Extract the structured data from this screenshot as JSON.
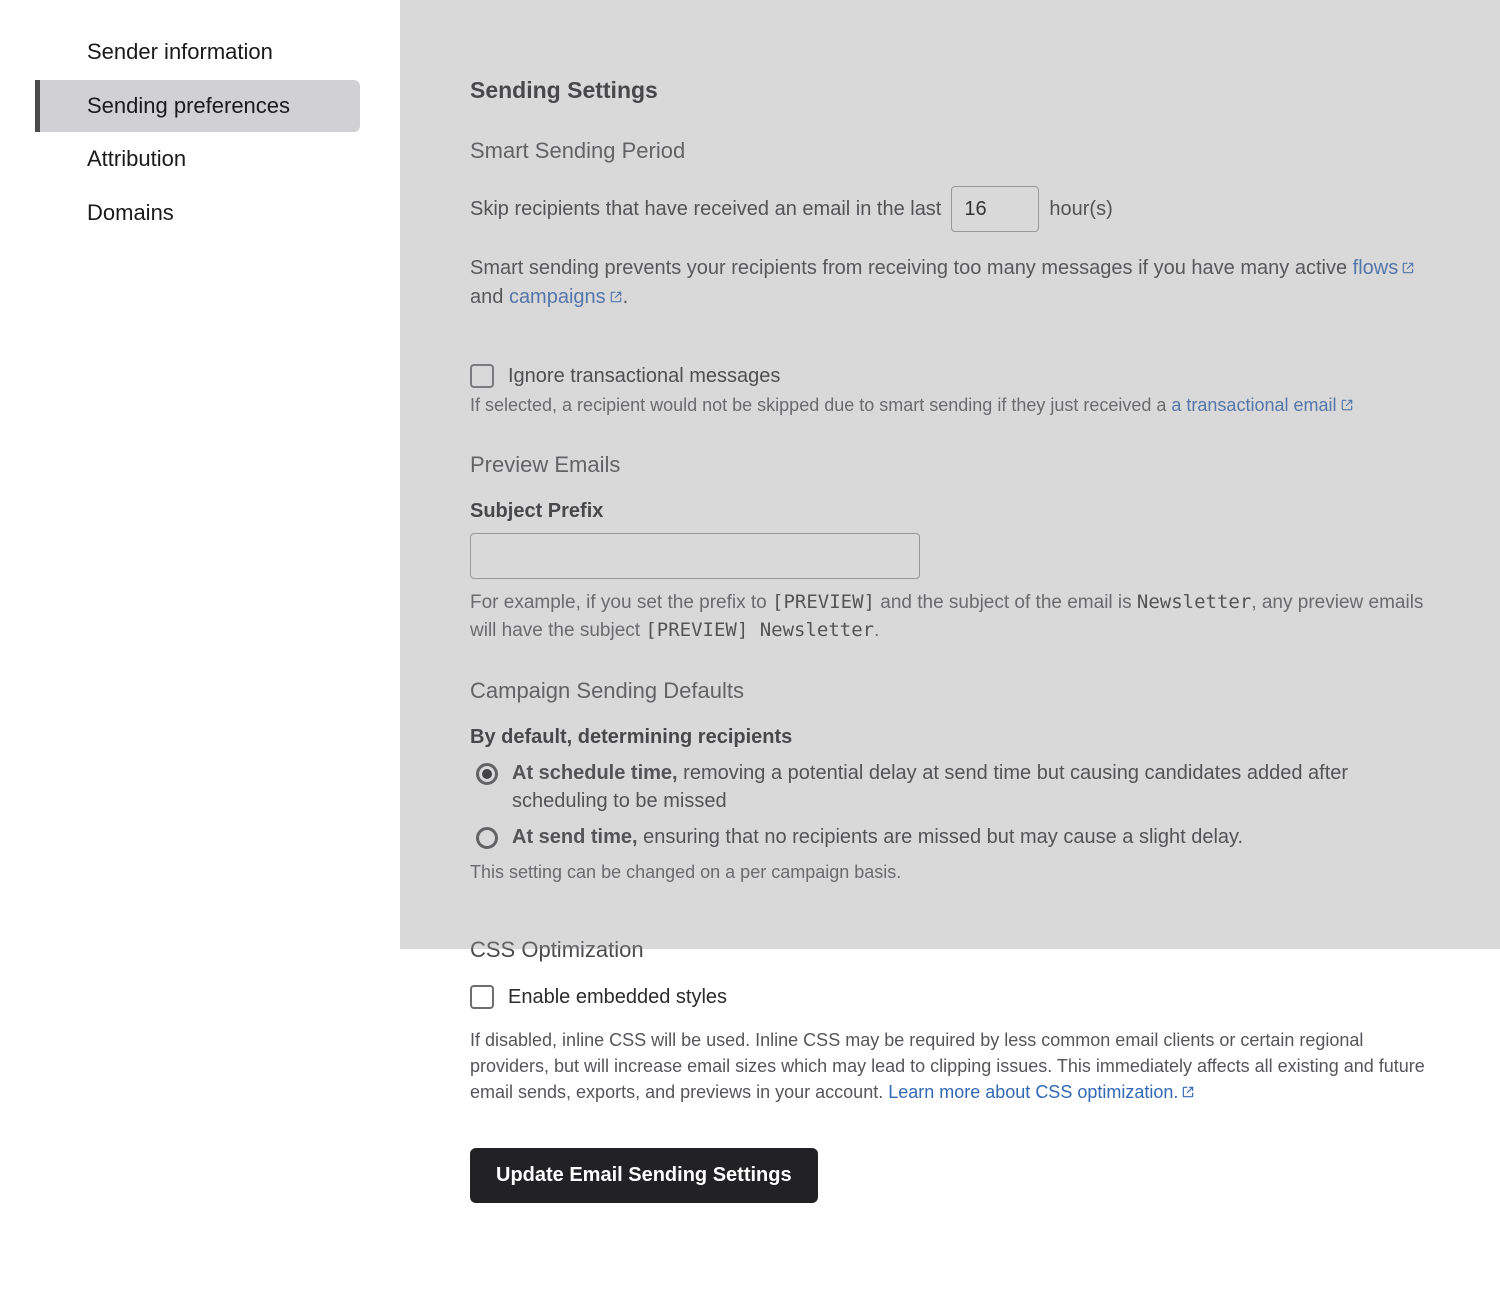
{
  "sidebar": {
    "items": [
      {
        "label": "Sender information"
      },
      {
        "label": "Sending preferences"
      },
      {
        "label": "Attribution"
      },
      {
        "label": "Domains"
      }
    ]
  },
  "settings": {
    "heading": "Sending Settings",
    "smart_sending": {
      "title": "Smart Sending Period",
      "skip_pre": "Skip recipients that have received an email in the last",
      "hours_value": "16",
      "skip_post": "hour(s)",
      "desc_pre": "Smart sending prevents your recipients from receiving too many messages if you have many active ",
      "link_flows": "flows",
      "desc_mid": " and ",
      "link_campaigns": "campaigns",
      "desc_post": ".",
      "ignore_label": "Ignore transactional messages",
      "ignore_help_pre": "If selected, a recipient would not be skipped due to smart sending if they just received a ",
      "ignore_link": "a transactional email"
    },
    "preview": {
      "title": "Preview Emails",
      "subject_prefix_label": "Subject Prefix",
      "subject_prefix_value": "",
      "example_pre": "For example, if you set the prefix to ",
      "example_code1": "[PREVIEW]",
      "example_mid": " and the subject of the email is ",
      "example_code2": "Newsletter",
      "example_mid2": ", any preview emails will have the subject ",
      "example_code3": "[PREVIEW] Newsletter",
      "example_post": "."
    },
    "campaign_defaults": {
      "title": "Campaign Sending Defaults",
      "lead": "By default, determining recipients",
      "opt1_bold": "At schedule time,",
      "opt1_rest": " removing a potential delay at send time but causing candidates added after scheduling to be missed",
      "opt2_bold": "At send time,",
      "opt2_rest": " ensuring that no recipients are missed but may cause a slight delay.",
      "note": "This setting can be changed on a per campaign basis."
    },
    "css_opt": {
      "title": "CSS Optimization",
      "checkbox_label": "Enable embedded styles",
      "help_pre": "If disabled, inline CSS will be used. Inline CSS may be required by less common email clients or certain regional providers, but will increase email sizes which may lead to clipping issues. This immediately affects all existing and future email sends, exports, and previews in your account. ",
      "learn_link": "Learn more about CSS optimization."
    },
    "submit_label": "Update Email Sending Settings"
  }
}
